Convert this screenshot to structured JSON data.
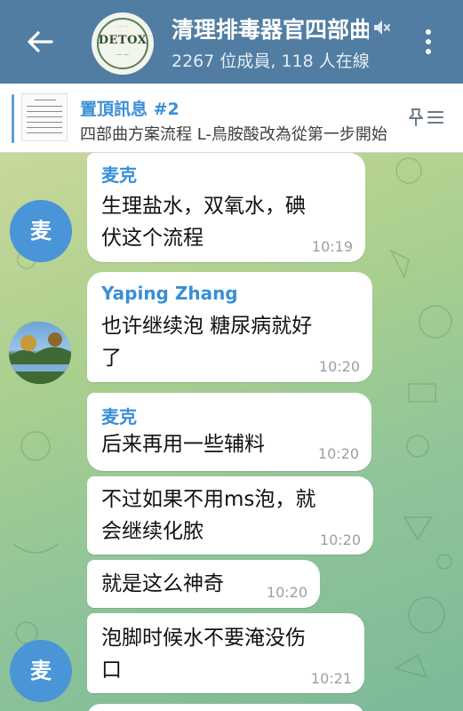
{
  "header": {
    "title": "清理排毒器官四部曲",
    "subtitle": "2267 位成員, 118 人在線",
    "avatar_logo": "DETOX"
  },
  "pinned": {
    "title": "置頂訊息 #2",
    "text": "四部曲方案流程 L-鳥胺酸改為從第一步開始"
  },
  "messages": [
    {
      "sender": "麦克",
      "sender_color": "#3a8fd6",
      "lines": [
        "生理盐水，双氧水，碘",
        "伏这个流程"
      ],
      "time": "10:19"
    },
    {
      "sender": "Yaping Zhang",
      "sender_color": "#3a8fd6",
      "lines": [
        "也许继续泡 糖尿病就好",
        "了"
      ],
      "time": "10:20"
    },
    {
      "sender": "麦克",
      "sender_color": "#3a8fd6",
      "lines": [
        "后来再用一些辅料"
      ],
      "time": "10:20"
    },
    {
      "sender": "",
      "lines": [
        "不过如果不用ms泡，就",
        "会继续化脓"
      ],
      "time": "10:20"
    },
    {
      "sender": "",
      "lines": [
        "就是这么神奇"
      ],
      "time": "10:20"
    },
    {
      "sender": "",
      "lines": [
        "泡脚时候水不要淹没伤",
        "口"
      ],
      "time": "10:21"
    }
  ],
  "avatars": {
    "mai_initial": "麦"
  },
  "colors": {
    "header_bg": "#517da2",
    "accent": "#3a8fd6",
    "avatar_mai": "#4a95d8"
  },
  "icons": [
    "back-arrow-icon",
    "mute-icon",
    "more-vertical-icon",
    "pin-list-icon"
  ]
}
